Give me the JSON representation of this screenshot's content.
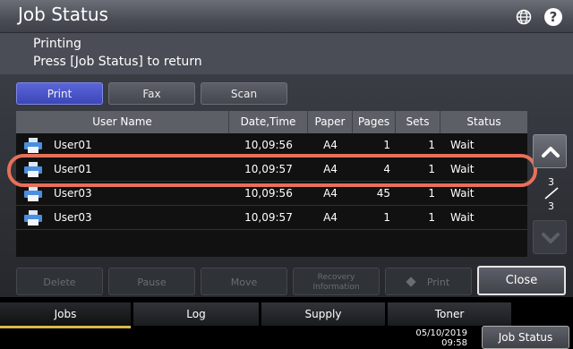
{
  "header": {
    "title": "Job Status",
    "globe_icon": "globe-icon",
    "help_label": "?"
  },
  "message": {
    "line1": "Printing",
    "line2": "Press [Job Status] to return"
  },
  "job_type_tabs": [
    {
      "label": "Print",
      "active": true
    },
    {
      "label": "Fax",
      "active": false
    },
    {
      "label": "Scan",
      "active": false
    }
  ],
  "table": {
    "columns": [
      "User Name",
      "Date,Time",
      "Paper",
      "Pages",
      "Sets",
      "Status"
    ],
    "rows": [
      {
        "user": "User01",
        "datetime": "10,09:56",
        "paper": "A4",
        "pages": "1",
        "sets": "1",
        "status": "Wait"
      },
      {
        "user": "User01",
        "datetime": "10,09:57",
        "paper": "A4",
        "pages": "4",
        "sets": "1",
        "status": "Wait"
      },
      {
        "user": "User03",
        "datetime": "10,09:56",
        "paper": "A4",
        "pages": "45",
        "sets": "1",
        "status": "Wait"
      },
      {
        "user": "User03",
        "datetime": "10,09:57",
        "paper": "A4",
        "pages": "1",
        "sets": "1",
        "status": "Wait"
      }
    ],
    "highlighted_row": 1
  },
  "pagination": {
    "current": "3",
    "total": "3"
  },
  "actions": {
    "delete": "Delete",
    "pause": "Pause",
    "move": "Move",
    "recovery_line1": "Recovery",
    "recovery_line2": "Information",
    "print": "Print",
    "close": "Close"
  },
  "bottom_tabs": [
    {
      "label": "Jobs",
      "active": true
    },
    {
      "label": "Log",
      "active": false
    },
    {
      "label": "Supply",
      "active": false
    },
    {
      "label": "Toner",
      "active": false
    }
  ],
  "footer": {
    "date": "05/10/2019",
    "time": "09:58",
    "job_status_label": "Job Status"
  },
  "colors": {
    "accent_tab": "#4450c8",
    "highlight": "#e8705a",
    "active_underline": "#d9b94a"
  }
}
